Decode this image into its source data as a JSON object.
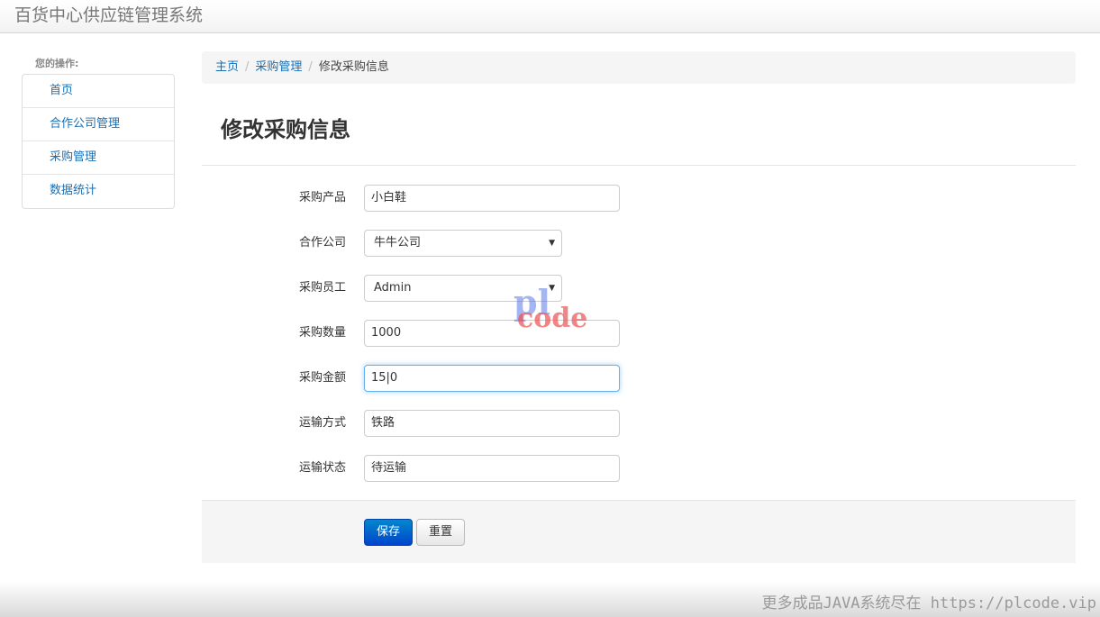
{
  "app": {
    "title": "百货中心供应链管理系统"
  },
  "sidebar": {
    "header": "您的操作:",
    "items": [
      {
        "label": "首页"
      },
      {
        "label": "合作公司管理"
      },
      {
        "label": "采购管理"
      },
      {
        "label": "数据统计"
      }
    ]
  },
  "breadcrumb": {
    "home": "主页",
    "section": "采购管理",
    "current": "修改采购信息"
  },
  "page": {
    "title": "修改采购信息"
  },
  "form": {
    "product": {
      "label": "采购产品",
      "value": "小白鞋"
    },
    "company": {
      "label": "合作公司",
      "value": "牛牛公司"
    },
    "employee": {
      "label": "采购员工",
      "value": "Admin"
    },
    "quantity": {
      "label": "采购数量",
      "value": "1000"
    },
    "amount": {
      "label": "采购金额",
      "value": "15|0"
    },
    "transport": {
      "label": "运输方式",
      "value": "铁路"
    },
    "status": {
      "label": "运输状态",
      "value": "待运输"
    }
  },
  "actions": {
    "save": "保存",
    "reset": "重置"
  },
  "watermark": {
    "line1": "pl",
    "line2": "code"
  },
  "footer": {
    "text": "更多成品JAVA系统尽在 https://plcode.vip"
  }
}
